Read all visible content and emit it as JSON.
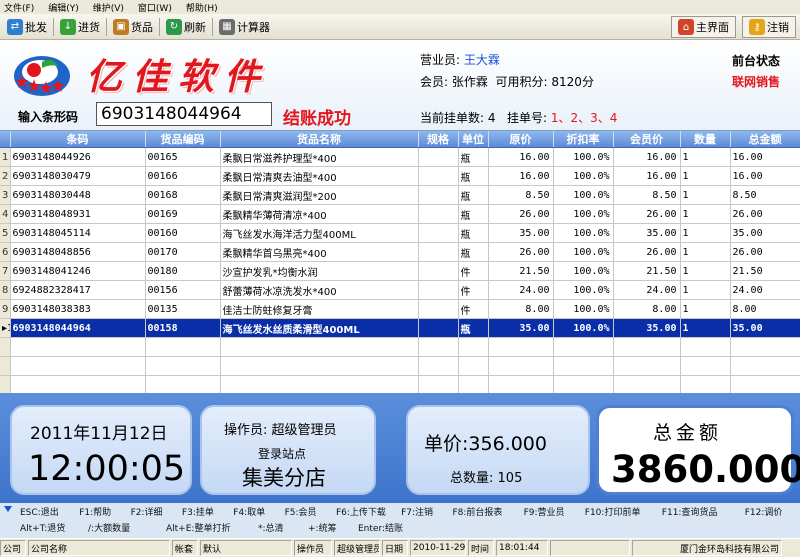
{
  "menu": [
    "文件(F)",
    "编辑(Y)",
    "维护(V)",
    "窗口(W)",
    "帮助(H)"
  ],
  "toolbar": {
    "items": [
      {
        "label": "批发",
        "icon": "wholesale-icon",
        "color": "#2e7fd0"
      },
      {
        "label": "进货",
        "icon": "restock-icon",
        "color": "#3aa03a"
      },
      {
        "label": "货品",
        "icon": "goods-icon",
        "color": "#c07a20"
      },
      {
        "label": "刷新",
        "icon": "refresh-icon",
        "color": "#2a9a4a"
      },
      {
        "label": "计算器",
        "icon": "calculator-icon",
        "color": "#6b6b6b"
      }
    ],
    "home_label": "主界面",
    "logout_label": "注销"
  },
  "header": {
    "brand": "亿佳软件",
    "salesperson_label": "营业员:",
    "salesperson": "王大霖",
    "member_label": "会员:",
    "member": "张作霖",
    "points_label": "可用积分:",
    "points": "8120分",
    "front_status": "前台状态",
    "online_sales": "联网销售",
    "barcode_label": "输入条形码",
    "barcode_value": "6903148044964",
    "checkout_status": "结账成功",
    "pending_label": "当前挂单数:",
    "pending_count": "4",
    "pending_no_label": "挂单号:",
    "pending_nos": "1、2、3、4"
  },
  "table": {
    "columns": [
      "",
      "条码",
      "货品编码",
      "货品名称",
      "规格",
      "单位",
      "原价",
      "折扣率",
      "会员价",
      "数量",
      "总金额"
    ],
    "rows": [
      [
        "1",
        "6903148044926",
        "00165",
        "柔飘日常滋养护理型*400",
        "",
        "瓶",
        "16.00",
        "100.0%",
        "16.00",
        "1",
        "16.00"
      ],
      [
        "2",
        "6903148030479",
        "00166",
        "柔飘日常清爽去油型*400",
        "",
        "瓶",
        "16.00",
        "100.0%",
        "16.00",
        "1",
        "16.00"
      ],
      [
        "3",
        "6903148030448",
        "00168",
        "柔飘日常清爽滋润型*200",
        "",
        "瓶",
        "8.50",
        "100.0%",
        "8.50",
        "1",
        "8.50"
      ],
      [
        "4",
        "6903148048931",
        "00169",
        "柔飘精华薄荷清凉*400",
        "",
        "瓶",
        "26.00",
        "100.0%",
        "26.00",
        "1",
        "26.00"
      ],
      [
        "5",
        "6903148045114",
        "00160",
        "海飞丝发水海洋活力型400ML",
        "",
        "瓶",
        "35.00",
        "100.0%",
        "35.00",
        "1",
        "35.00"
      ],
      [
        "6",
        "6903148048856",
        "00170",
        "柔飘精华首乌黑亮*400",
        "",
        "瓶",
        "26.00",
        "100.0%",
        "26.00",
        "1",
        "26.00"
      ],
      [
        "7",
        "6903148041246",
        "00180",
        "沙宣护发乳*均衡水润",
        "",
        "件",
        "21.50",
        "100.0%",
        "21.50",
        "1",
        "21.50"
      ],
      [
        "8",
        "6924882328417",
        "00156",
        "舒蕾薄荷冰凉洗发水*400",
        "",
        "件",
        "24.00",
        "100.0%",
        "24.00",
        "1",
        "24.00"
      ],
      [
        "9",
        "6903148038383",
        "00135",
        "佳洁士防蛀修复牙膏",
        "",
        "件",
        "8.00",
        "100.0%",
        "8.00",
        "1",
        "8.00"
      ],
      [
        "10",
        "6903148044964",
        "00158",
        "海飞丝发水丝质柔滑型400ML",
        "",
        "瓶",
        "35.00",
        "100.0%",
        "35.00",
        "1",
        "35.00"
      ]
    ],
    "selected_row": 9,
    "selected_marker": "▸"
  },
  "summary": {
    "date": "2011年11月12日",
    "time": "12:00:05",
    "operator_label": "操作员:",
    "operator": "超级管理员",
    "site_label": "登录站点",
    "site": "集美分店",
    "unit_price_label": "单价:",
    "unit_price": "356.000",
    "total_qty_label": "总数量:",
    "total_qty": "105",
    "total_label": "总金额",
    "total": "3860.000"
  },
  "shortcuts": {
    "row1": [
      "ESC:退出",
      "F1:帮助",
      "F2:详细",
      "F3:挂单",
      "F4:取单",
      "F5:会员",
      "F6:上传下载",
      "F7:注销",
      "F8:前台报表",
      "F9:营业员",
      "F10:打印前单",
      "F11:查询货品",
      "F12:调价"
    ],
    "row2": [
      "Alt+T:退货",
      "/:大额数量",
      "Alt+E:整单打折",
      "*:总清",
      "+:统筹",
      "Enter:结账"
    ]
  },
  "statusbar": {
    "company_label": "公司",
    "company_name": "公司名称",
    "account_label": "帐套",
    "account": "默认",
    "operator_label": "操作员",
    "operator": "超级管理员",
    "date_label": "日期",
    "date": "2010-11-29",
    "time_label": "时间",
    "time": "18:01:44",
    "vendor": "厦门金环岛科技有限公司"
  },
  "colors": {
    "brand_red": "#e2171e",
    "header_blue": "#5d8ad6",
    "selection": "#0a2ea8",
    "link_blue": "#1a4fd6"
  }
}
